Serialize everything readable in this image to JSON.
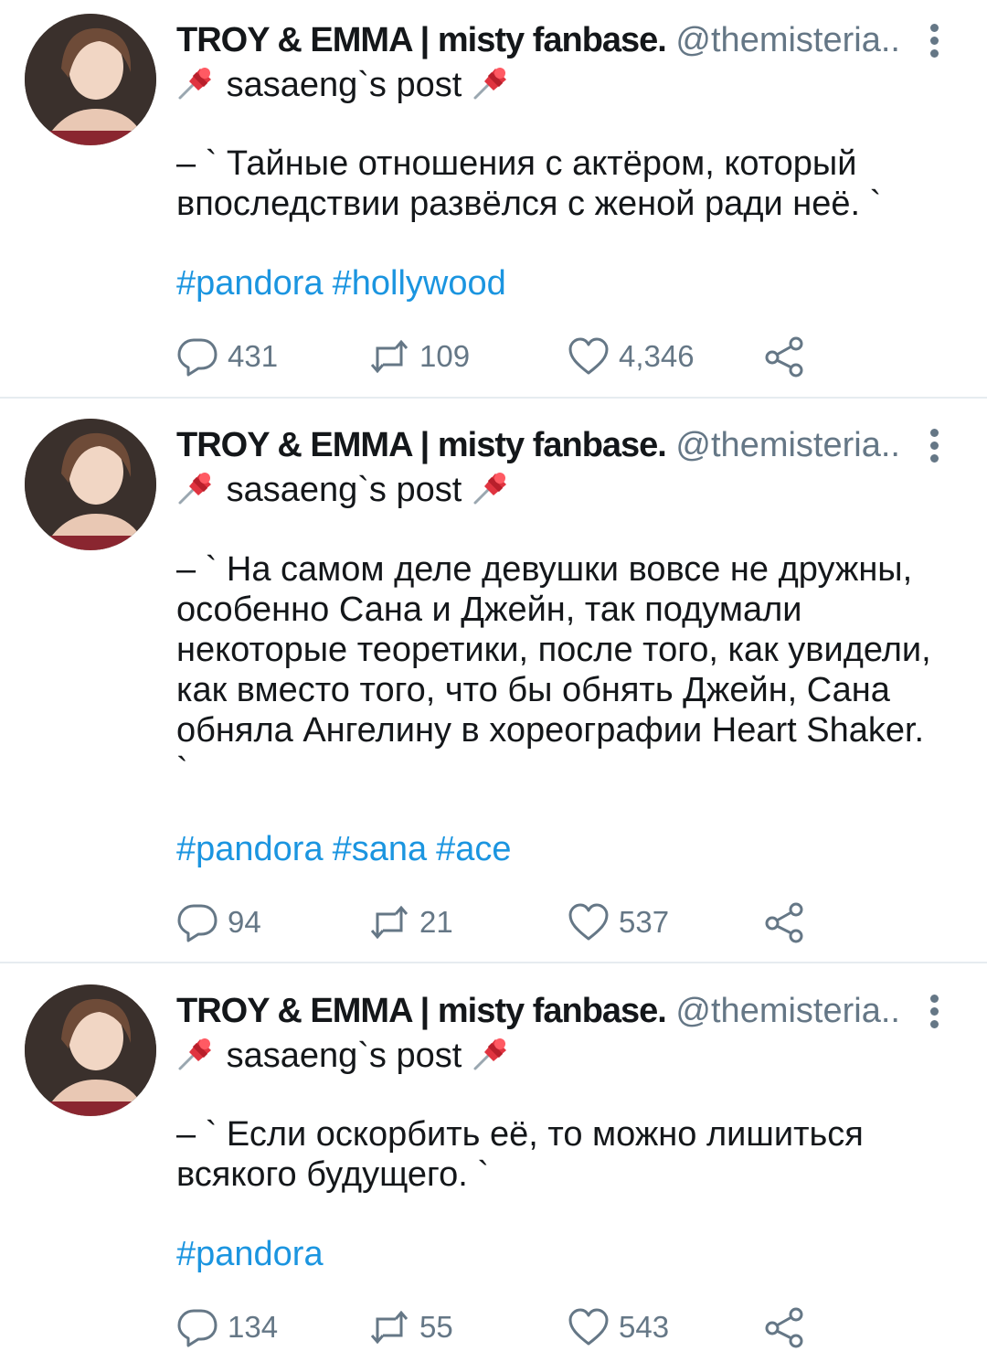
{
  "tweets": [
    {
      "author": "TROY & EMMA | misty fanbase.",
      "handle": "@themisteria..",
      "pin_text": "sasaeng`s post",
      "text": "– ` Тайные отношения с актёром, который впоследствии развёлся с женой ради неё. `",
      "hashtags": [
        "#pandora",
        "#hollywood"
      ],
      "replies": "431",
      "retweets": "109",
      "likes": "4,346"
    },
    {
      "author": "TROY & EMMA | misty fanbase.",
      "handle": "@themisteria..",
      "pin_text": "sasaeng`s post",
      "text": "– ` На самом деле девушки вовсе не дружны, особенно Сана и Джейн, так подумали некоторые теоретики, после того, как увидели, как вместо того, что бы обнять Джейн, Сана обняла Ангелину в хореографии Heart Shaker. `",
      "hashtags": [
        "#pandora",
        "#sana",
        "#ace"
      ],
      "replies": "94",
      "retweets": "21",
      "likes": "537"
    },
    {
      "author": "TROY & EMMA | misty fanbase.",
      "handle": "@themisteria..",
      "pin_text": "sasaeng`s post",
      "text": "– ` Если оскорбить её, то можно лишиться всякого будущего. `",
      "hashtags": [
        "#pandora"
      ],
      "replies": "134",
      "retweets": "55",
      "likes": "543"
    }
  ],
  "icons": {
    "pin": "pushpin-icon",
    "reply": "reply-icon",
    "retweet": "retweet-icon",
    "like": "heart-icon",
    "share": "share-icon",
    "more": "more-icon"
  },
  "colors": {
    "hashtag": "#1b95e0",
    "muted": "#657786",
    "text": "#14171a",
    "divider": "#e6ecf0"
  }
}
